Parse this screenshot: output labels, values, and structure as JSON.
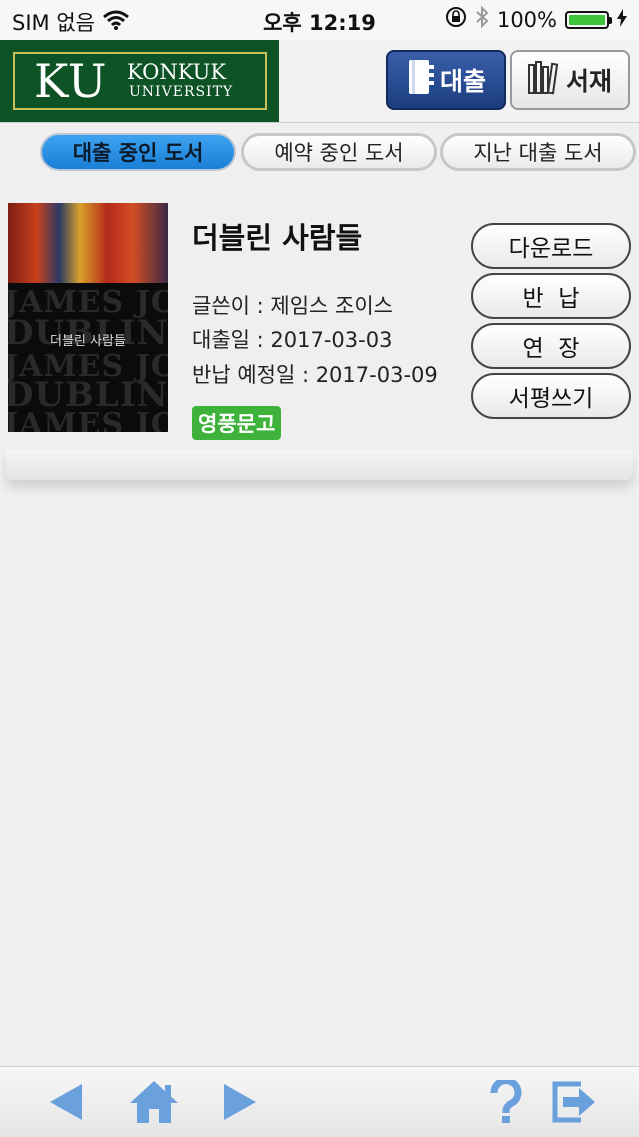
{
  "status_bar": {
    "carrier": "SIM 없음",
    "time": "오후 12:19",
    "battery": "100%",
    "battery_level": 1.0,
    "battery_color": "#3ec43a"
  },
  "header": {
    "logo": {
      "mark": "KU",
      "line1": "KONKUK",
      "line2": "UNIVERSITY",
      "bg_color": "#0d5326"
    },
    "loan_button": "대출",
    "shelf_button": "서재"
  },
  "tabs": [
    {
      "label": "대출 중인 도서",
      "active": true
    },
    {
      "label": "예약 중인 도서",
      "active": false
    },
    {
      "label": "지난 대출 도서",
      "active": false
    }
  ],
  "book": {
    "title": "더블린 사람들",
    "author_line": "글쓴이 : 제임스 조이스",
    "loan_date_line": "대출일 : 2017-03-03",
    "due_date_line": "반납 예정일 : 2017-03-09",
    "badge": "영풍문고",
    "badge_color": "#3fb23b",
    "cover": {
      "title": "더블린 사람들",
      "words": [
        "JAMES JOYCE",
        "DUBLINERS",
        "JAMES JOYCE",
        "DUBLINERS",
        "JAMES JOYCE"
      ]
    }
  },
  "actions": {
    "download": "다운로드",
    "return": "반  납",
    "extend": "연  장",
    "review": "서평쓰기"
  },
  "bottom_bar": {
    "back": "back-arrow-icon",
    "home": "home-icon",
    "forward": "forward-arrow-icon",
    "help": "help-icon",
    "exit": "exit-icon",
    "icon_color": "#6aa0dc"
  }
}
